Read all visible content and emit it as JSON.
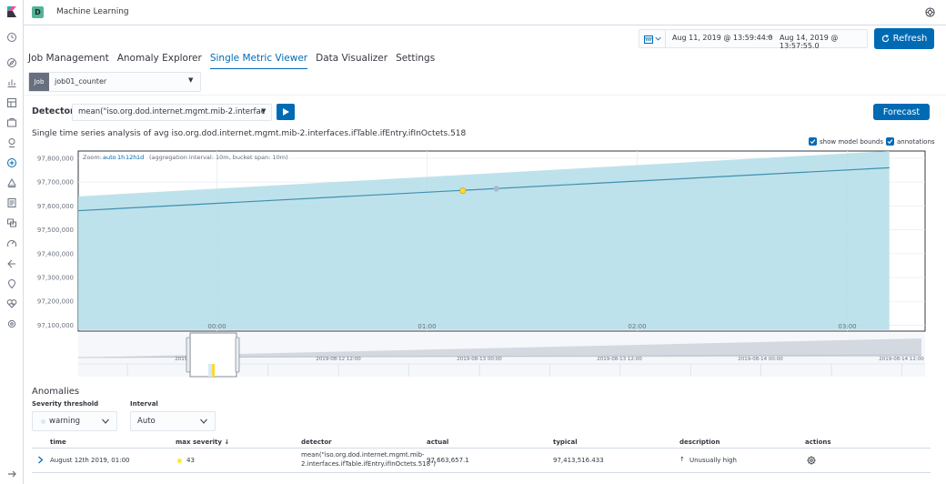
{
  "header": {
    "space_initial": "D",
    "space_color": "#54b399",
    "app_title": "Machine Learning"
  },
  "nav_icons": [
    "clock-icon",
    "discover-compass-icon",
    "visualize-chart-icon",
    "dashboard-icon",
    "canvas-icon",
    "maps-icon",
    "machine-learning-icon",
    "infrastructure-icon",
    "logs-icon",
    "apm-icon",
    "uptime-icon",
    "dev-tools-icon",
    "stack-monitoring-icon",
    "heartbeat-icon",
    "management-gear-icon"
  ],
  "datepicker": {
    "start": "Aug 11, 2019 @ 13:59:44.0",
    "arrow": "→",
    "end": "Aug 14, 2019 @ 13:57:55.0"
  },
  "refresh_label": "Refresh",
  "tabs": [
    {
      "label": "Job Management",
      "active": false
    },
    {
      "label": "Anomaly Explorer",
      "active": false
    },
    {
      "label": "Single Metric Viewer",
      "active": true
    },
    {
      "label": "Data Visualizer",
      "active": false
    },
    {
      "label": "Settings",
      "active": false
    }
  ],
  "job": {
    "prepend": "Job",
    "value": "job01_counter"
  },
  "detector": {
    "label": "Detector:",
    "value": "mean(\"iso.org.dod.internet.mgmt.mib-2.interfac"
  },
  "forecast_label": "Forecast",
  "series_title": "Single time series analysis of avg iso.org.dod.internet.mgmt.mib-2.interfaces.ifTable.ifEntry.ifInOctets.518",
  "checkboxes": {
    "model_bounds": "show model bounds",
    "annotations": "annotations"
  },
  "chart_data": {
    "type": "line",
    "zoom_prefix": "Zoom:",
    "zoom_options": [
      "auto",
      "1h",
      "12h",
      "1d"
    ],
    "zoom_info": "(aggregation interval: 10m, bucket span: 10m)",
    "y_ticks": [
      "97,800,000",
      "97,700,000",
      "97,600,000",
      "97,500,000",
      "97,400,000",
      "97,300,000",
      "97,200,000",
      "97,100,000"
    ],
    "y_tick_values": [
      97800000,
      97700000,
      97600000,
      97500000,
      97400000,
      97300000,
      97200000,
      97100000
    ],
    "ylim": [
      97075000,
      97830000
    ],
    "x_ticks": [
      "00:00",
      "01:00",
      "02:00",
      "03:00"
    ],
    "x_tick_positions_hours": [
      0,
      1,
      2,
      3
    ],
    "xlim_hours": [
      -0.66,
      3.37
    ],
    "series": [
      {
        "name": "actual",
        "x_hours": [
          -0.66,
          3.2
        ],
        "values": [
          97580000,
          97760000
        ]
      }
    ],
    "model_bounds": {
      "x_hours": [
        -0.66,
        3.2
      ],
      "upper": [
        97640000,
        97830000
      ],
      "lower": [
        97080000,
        97080000
      ]
    },
    "anomaly_marker": {
      "x_hours": 1.17,
      "value": 97663657,
      "color": "#fdd835"
    },
    "secondary_marker": {
      "x_hours": 1.33,
      "value": 97672000,
      "color": "#a7b9cf"
    },
    "colors": {
      "line": "#3f8fb0",
      "bounds": "#b3dde8",
      "anomaly": "#fdd835"
    },
    "context": {
      "x_labels": [
        "2019-08-12 00:00",
        "2019-08-12 12:00",
        "2019-08-13 00:00",
        "2019-08-13 12:00",
        "2019-08-14 00:00",
        "2019-08-14 12:00"
      ]
    }
  },
  "anomalies": {
    "title": "Anomalies",
    "severity_label": "Severity threshold",
    "severity_value": "warning",
    "interval_label": "Interval",
    "interval_value": "Auto",
    "columns": [
      "time",
      "max severity",
      "detector",
      "actual",
      "typical",
      "description",
      "actions"
    ],
    "sort_arrow": "↓",
    "rows": [
      {
        "time": "August 12th 2019, 01:00",
        "severity": "43",
        "detector_line1": "mean(\"iso.org.dod.internet.mgmt.mib-",
        "detector_line2": "2.interfaces.ifTable.ifEntry.ifInOctets.518\")",
        "actual": "97,663,657.1",
        "typical": "97,413,516.433",
        "direction": "↑",
        "description": "Unusually high"
      }
    ]
  }
}
